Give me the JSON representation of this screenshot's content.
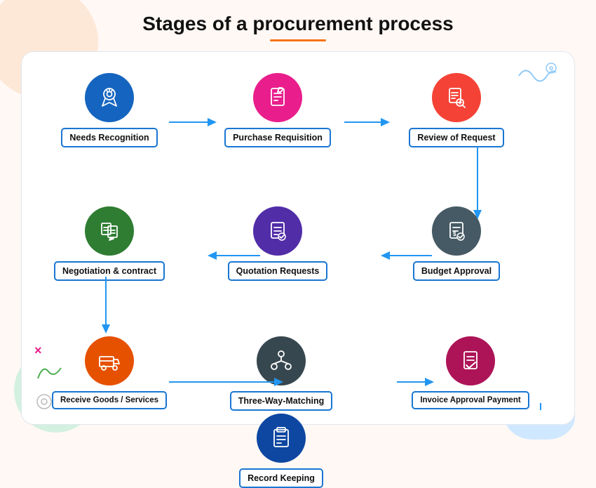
{
  "page": {
    "title": "Stages of a procurement process",
    "background_color": "#fff8f5"
  },
  "stages": [
    {
      "id": "needs-recognition",
      "label": "Needs Recognition",
      "icon_color": "#1565C0",
      "icon": "award",
      "row": 1,
      "col": 1
    },
    {
      "id": "purchase-requisition",
      "label": "Purchase Requisition",
      "icon_color": "#C2185B",
      "icon": "clipboard",
      "row": 1,
      "col": 2
    },
    {
      "id": "review-of-request",
      "label": "Review of Request",
      "icon_color": "#E53935",
      "icon": "search-doc",
      "row": 1,
      "col": 3
    },
    {
      "id": "negotiation-contract",
      "label": "Negotiation & contract",
      "icon_color": "#2E7D32",
      "icon": "deal",
      "row": 2,
      "col": 1
    },
    {
      "id": "quotation-requests",
      "label": "Quotation Requests",
      "icon_color": "#512DA8",
      "icon": "quote",
      "row": 2,
      "col": 2
    },
    {
      "id": "budget-approval",
      "label": "Budget Approval",
      "icon_color": "#455A64",
      "icon": "budget",
      "row": 2,
      "col": 3
    },
    {
      "id": "receive-goods",
      "label": "Receive Goods / Services",
      "icon_color": "#E65100",
      "icon": "truck",
      "row": 3,
      "col": 1
    },
    {
      "id": "three-way-matching",
      "label": "Three-Way-Matching",
      "icon_color": "#37474F",
      "icon": "network",
      "row": 3,
      "col": 2
    },
    {
      "id": "invoice-approval",
      "label": "Invoice Approval Payment",
      "icon_color": "#AD1457",
      "icon": "invoice",
      "row": 3,
      "col": 3
    },
    {
      "id": "record-keeping",
      "label": "Record Keeping",
      "icon_color": "#0D47A1",
      "icon": "records",
      "row": 4,
      "col": 2
    }
  ],
  "arrows": {
    "color": "#2196f3"
  }
}
